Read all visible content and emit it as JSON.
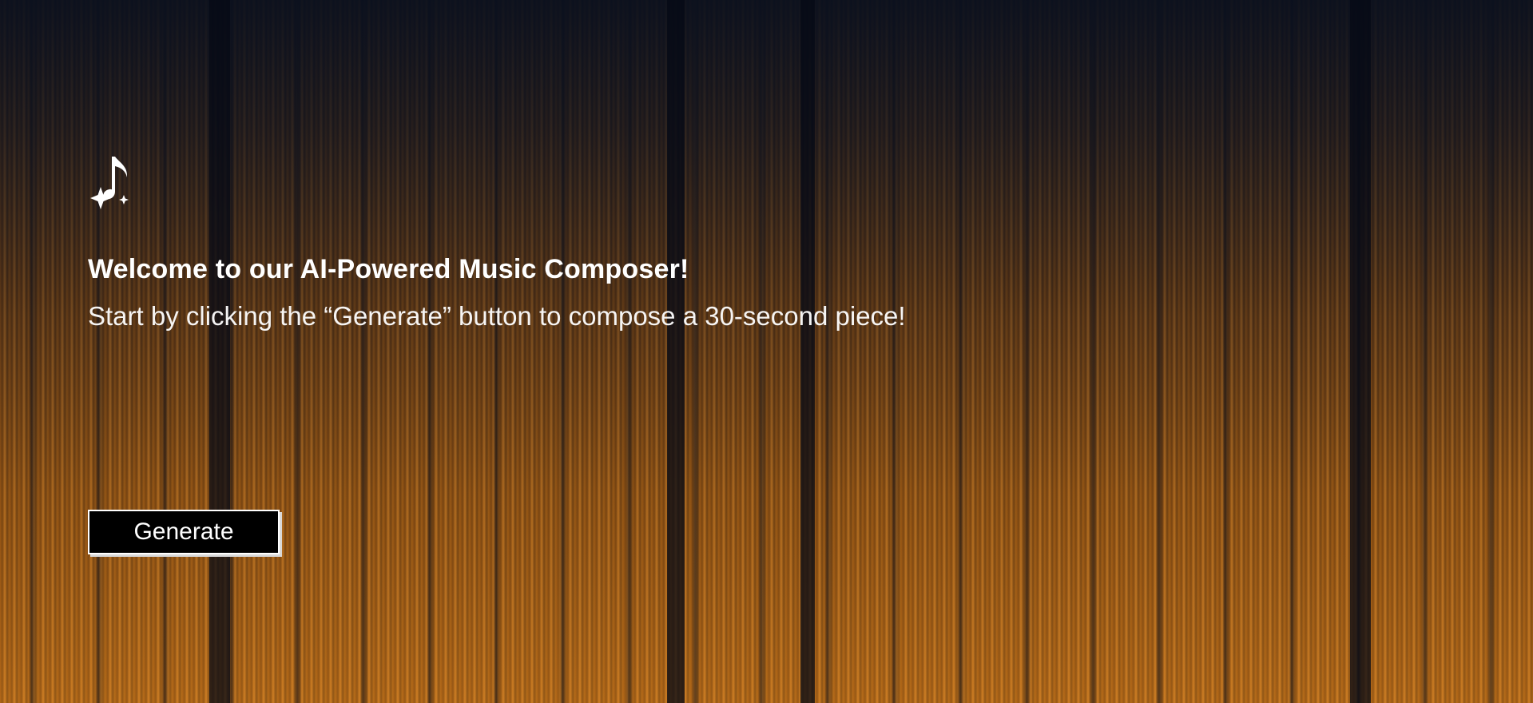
{
  "hero": {
    "logo_icon": "music-note-sparkle-icon",
    "title": "Welcome to our AI-Powered Music Composer!",
    "subtitle": "Start by clicking the “Generate” button to compose a 30-second piece!"
  },
  "actions": {
    "generate_label": "Generate"
  },
  "colors": {
    "text": "#ffffff",
    "button_bg": "#000000",
    "accent_orange": "#c57a1f",
    "background_dark": "#0b1322"
  }
}
